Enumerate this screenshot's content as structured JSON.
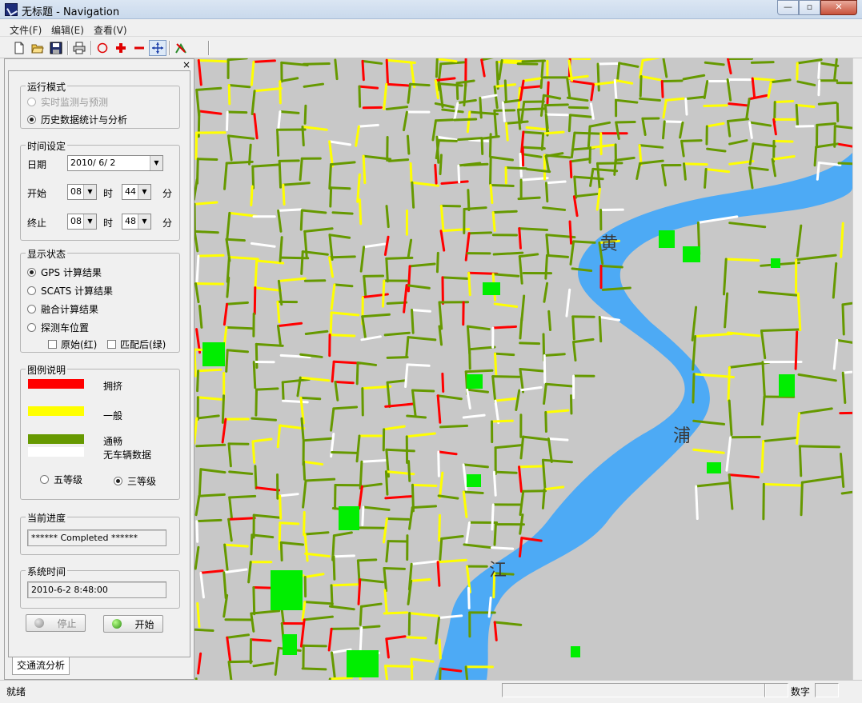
{
  "window": {
    "title": "无标题 - Navigation",
    "minimize": "—",
    "maximize": "▫",
    "close": "✕"
  },
  "menu": [
    "文件(F)",
    "编辑(E)",
    "查看(V)"
  ],
  "toolbar_icons": [
    "new-file-icon",
    "open-folder-icon",
    "save-icon",
    "print-icon",
    "circle-select-icon",
    "zoom-in-icon",
    "zoom-out-icon",
    "pan-icon",
    "route-icon"
  ],
  "panel": {
    "close": "×",
    "run_mode": {
      "title": "运行模式",
      "options": [
        {
          "label": "实时监测与预测",
          "selected": false,
          "disabled": true
        },
        {
          "label": "历史数据统计与分析",
          "selected": true,
          "disabled": false
        }
      ]
    },
    "time": {
      "title": "时间设定",
      "date_label": "日期",
      "date_value": "2010/ 6/ 2",
      "start_label": "开始",
      "start_hour": "08",
      "start_min": "44",
      "end_label": "终止",
      "end_hour": "08",
      "end_min": "48",
      "hour_unit": "时",
      "min_unit": "分"
    },
    "display": {
      "title": "显示状态",
      "options": [
        {
          "label": "GPS 计算结果",
          "selected": true
        },
        {
          "label": "SCATS 计算结果",
          "selected": false
        },
        {
          "label": "融合计算结果",
          "selected": false
        },
        {
          "label": "探测车位置",
          "selected": false
        }
      ],
      "check_raw": "原始(红)",
      "check_matched": "匹配后(绿)"
    },
    "legend": {
      "title": "图例说明",
      "items": [
        {
          "label": "拥挤",
          "color": "#ff0000"
        },
        {
          "label": "一般",
          "color": "#ffff00"
        },
        {
          "label": "通畅",
          "color": "#669900"
        },
        {
          "label": "无车辆数据",
          "color": "#ffffff"
        }
      ],
      "level5": "五等级",
      "level3": "三等级",
      "level3_selected": true
    },
    "progress": {
      "title": "当前进度",
      "value": "****** Completed ******"
    },
    "system_time": {
      "title": "系统时间",
      "value": "2010-6-2  8:48:00"
    },
    "stop_button": "停止",
    "start_button": "开始",
    "tab": "交通流分析"
  },
  "map": {
    "river_labels": [
      "黄",
      "浦",
      "江"
    ],
    "colors": {
      "background": "#c8c8c8",
      "river": "#4daaf5",
      "park": "#00ee00",
      "congested": "#ff0000",
      "normal": "#ffff00",
      "smooth": "#669900",
      "no_data": "#ffffff"
    }
  },
  "status": {
    "text": "就绪",
    "numlock": "数字"
  }
}
